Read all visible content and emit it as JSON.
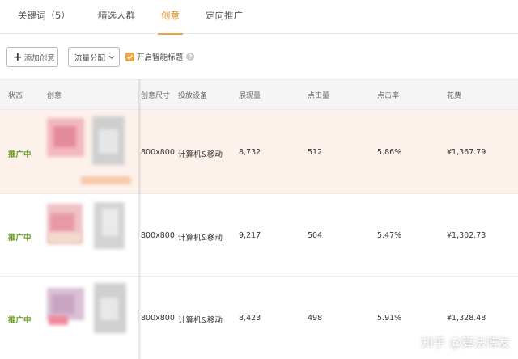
{
  "tabs": [
    {
      "label": "关键词（5）"
    },
    {
      "label": "精选人群"
    },
    {
      "label": "创意"
    },
    {
      "label": "定向推广"
    }
  ],
  "toolbar": {
    "add_label": "添加创意",
    "flow_label": "流量分配",
    "smart_title_label": "开启智能标题",
    "smart_title_checked": true
  },
  "table": {
    "headers": [
      "状态",
      "创意",
      "创意尺寸",
      "投放设备",
      "展现量",
      "点击量",
      "点击率",
      "花费"
    ],
    "rows": [
      {
        "status": "推广中",
        "size": "800x800",
        "device": "计算机&移动",
        "impressions": "8,732",
        "clicks": "512",
        "ctr": "5.86%",
        "cost": "¥1,367.79"
      },
      {
        "status": "推广中",
        "size": "800x800",
        "device": "计算机&移动",
        "impressions": "9,217",
        "clicks": "504",
        "ctr": "5.47%",
        "cost": "¥1,302.73"
      },
      {
        "status": "推广中",
        "size": "800x800",
        "device": "计算机&移动",
        "impressions": "8,423",
        "clicks": "498",
        "ctr": "5.91%",
        "cost": "¥1,328.48"
      }
    ]
  },
  "watermark": "知乎 @算法博友",
  "colors": {
    "accent": "#f2a23c",
    "status_green": "#69a024",
    "row_highlight": "#fdf1ec"
  }
}
